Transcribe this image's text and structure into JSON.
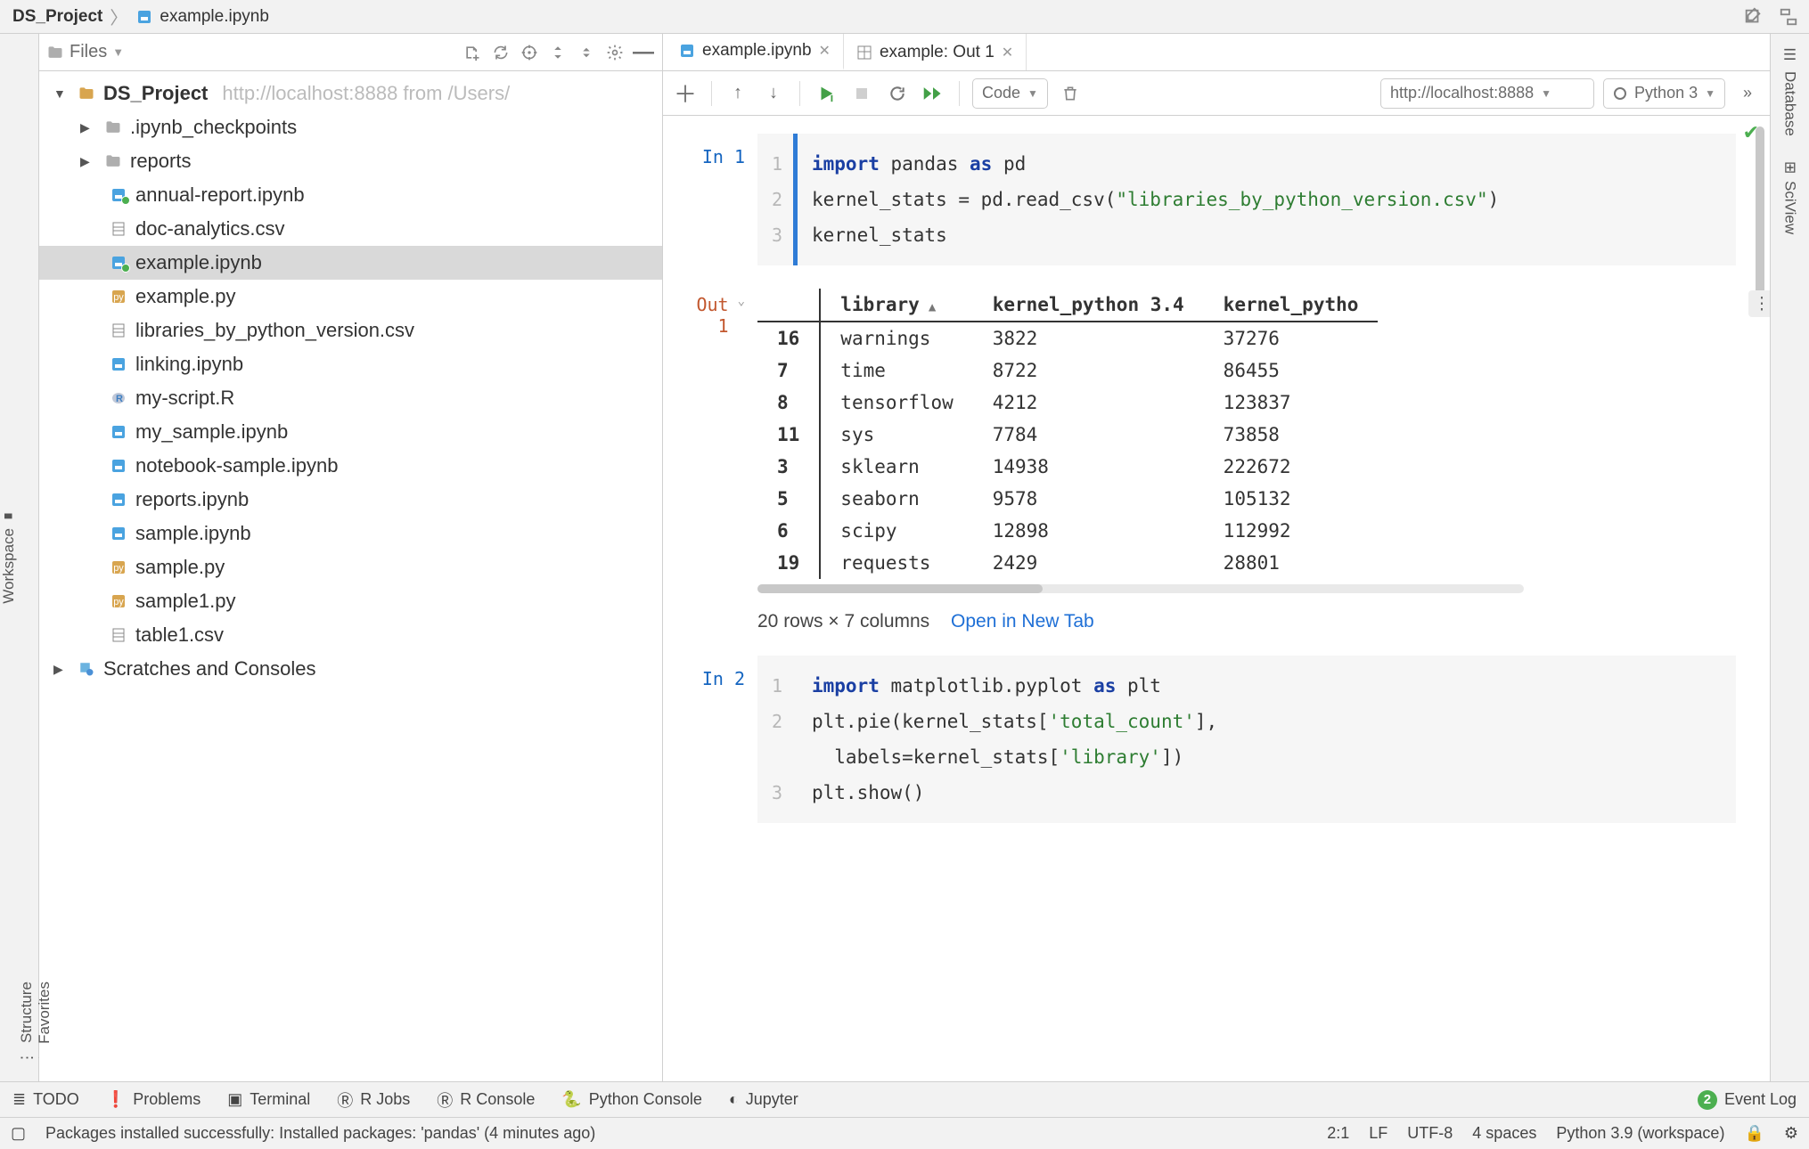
{
  "breadcrumb": {
    "root": "DS_Project",
    "file": "example.ipynb"
  },
  "sidebar_left": {
    "workspace": "Workspace",
    "structure": "Structure",
    "favorites": "Favorites"
  },
  "sidebar_right": {
    "database": "Database",
    "sciview": "SciView"
  },
  "panel": {
    "label": "Files"
  },
  "tree": {
    "root_name": "DS_Project",
    "root_extra": "http://localhost:8888 from /Users/",
    "folders": [
      ".ipynb_checkpoints",
      "reports"
    ],
    "files": [
      {
        "name": "annual-report.ipynb",
        "type": "ipynb",
        "dot": true
      },
      {
        "name": "doc-analytics.csv",
        "type": "csv"
      },
      {
        "name": "example.ipynb",
        "type": "ipynb",
        "dot": true,
        "selected": true
      },
      {
        "name": "example.py",
        "type": "py"
      },
      {
        "name": "libraries_by_python_version.csv",
        "type": "csv"
      },
      {
        "name": "linking.ipynb",
        "type": "ipynb"
      },
      {
        "name": "my-script.R",
        "type": "r"
      },
      {
        "name": "my_sample.ipynb",
        "type": "ipynb"
      },
      {
        "name": "notebook-sample.ipynb",
        "type": "ipynb"
      },
      {
        "name": "reports.ipynb",
        "type": "ipynb"
      },
      {
        "name": "sample.ipynb",
        "type": "ipynb"
      },
      {
        "name": "sample.py",
        "type": "py"
      },
      {
        "name": "sample1.py",
        "type": "py"
      },
      {
        "name": "table1.csv",
        "type": "csv"
      }
    ],
    "scratches": "Scratches and Consoles"
  },
  "tabs": [
    {
      "label": "example.ipynb",
      "icon": "ipynb",
      "active": true
    },
    {
      "label": "example: Out 1",
      "icon": "table",
      "active": false
    }
  ],
  "nbtoolbar": {
    "celltype": "Code",
    "server": "http://localhost:8888",
    "kernel": "Python 3"
  },
  "cells": {
    "in1": {
      "prompt": "In 1",
      "lines": [
        "1",
        "2",
        "3"
      ],
      "code_html": "<span class='kw'>import</span> pandas <span class='kw'>as</span> pd\nkernel_stats = pd.read_csv(<span class='str'>\"libraries_by_python_version.csv\"</span>)\nkernel_stats"
    },
    "out1": {
      "prompt": "Out 1",
      "summary": "20 rows × 7 columns",
      "open_label": "Open in New Tab",
      "columns": [
        "",
        "library",
        "kernel_python 3.4",
        "kernel_pytho"
      ],
      "rows": [
        [
          "16",
          "warnings",
          "3822",
          "37276"
        ],
        [
          "7",
          "time",
          "8722",
          "86455"
        ],
        [
          "8",
          "tensorflow",
          "4212",
          "123837"
        ],
        [
          "11",
          "sys",
          "7784",
          "73858"
        ],
        [
          "3",
          "sklearn",
          "14938",
          "222672"
        ],
        [
          "5",
          "seaborn",
          "9578",
          "105132"
        ],
        [
          "6",
          "scipy",
          "12898",
          "112992"
        ],
        [
          "19",
          "requests",
          "2429",
          "28801"
        ]
      ]
    },
    "in2": {
      "prompt": "In 2",
      "lines": [
        "1",
        "2",
        "",
        "3"
      ],
      "code_html": "<span class='kw'>import</span> matplotlib.pyplot <span class='kw'>as</span> plt\nplt.pie(kernel_stats[<span class='str'>'total_count'</span>],\n  labels=kernel_stats[<span class='str'>'library'</span>])\nplt.show()"
    }
  },
  "bottombar": {
    "todo": "TODO",
    "problems": "Problems",
    "terminal": "Terminal",
    "rjobs": "R Jobs",
    "rconsole": "R Console",
    "pyconsole": "Python Console",
    "jupyter": "Jupyter",
    "eventlog": "Event Log",
    "event_count": "2"
  },
  "statusbar": {
    "message": "Packages installed successfully: Installed packages: 'pandas' (4 minutes ago)",
    "pos": "2:1",
    "eol": "LF",
    "enc": "UTF-8",
    "indent": "4 spaces",
    "interp": "Python 3.9 (workspace)"
  }
}
